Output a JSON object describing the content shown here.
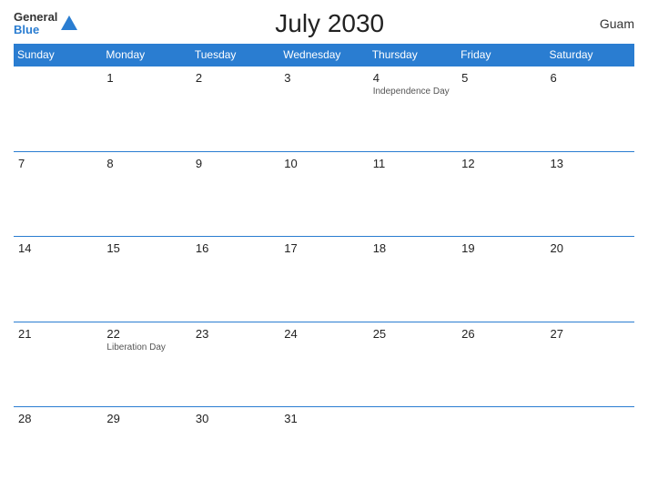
{
  "header": {
    "logo_general": "General",
    "logo_blue": "Blue",
    "title": "July 2030",
    "region": "Guam"
  },
  "calendar": {
    "days_of_week": [
      "Sunday",
      "Monday",
      "Tuesday",
      "Wednesday",
      "Thursday",
      "Friday",
      "Saturday"
    ],
    "weeks": [
      [
        {
          "date": "",
          "event": ""
        },
        {
          "date": "1",
          "event": ""
        },
        {
          "date": "2",
          "event": ""
        },
        {
          "date": "3",
          "event": ""
        },
        {
          "date": "4",
          "event": "Independence Day"
        },
        {
          "date": "5",
          "event": ""
        },
        {
          "date": "6",
          "event": ""
        }
      ],
      [
        {
          "date": "7",
          "event": ""
        },
        {
          "date": "8",
          "event": ""
        },
        {
          "date": "9",
          "event": ""
        },
        {
          "date": "10",
          "event": ""
        },
        {
          "date": "11",
          "event": ""
        },
        {
          "date": "12",
          "event": ""
        },
        {
          "date": "13",
          "event": ""
        }
      ],
      [
        {
          "date": "14",
          "event": ""
        },
        {
          "date": "15",
          "event": ""
        },
        {
          "date": "16",
          "event": ""
        },
        {
          "date": "17",
          "event": ""
        },
        {
          "date": "18",
          "event": ""
        },
        {
          "date": "19",
          "event": ""
        },
        {
          "date": "20",
          "event": ""
        }
      ],
      [
        {
          "date": "21",
          "event": ""
        },
        {
          "date": "22",
          "event": "Liberation Day"
        },
        {
          "date": "23",
          "event": ""
        },
        {
          "date": "24",
          "event": ""
        },
        {
          "date": "25",
          "event": ""
        },
        {
          "date": "26",
          "event": ""
        },
        {
          "date": "27",
          "event": ""
        }
      ],
      [
        {
          "date": "28",
          "event": ""
        },
        {
          "date": "29",
          "event": ""
        },
        {
          "date": "30",
          "event": ""
        },
        {
          "date": "31",
          "event": ""
        },
        {
          "date": "",
          "event": ""
        },
        {
          "date": "",
          "event": ""
        },
        {
          "date": "",
          "event": ""
        }
      ]
    ]
  }
}
